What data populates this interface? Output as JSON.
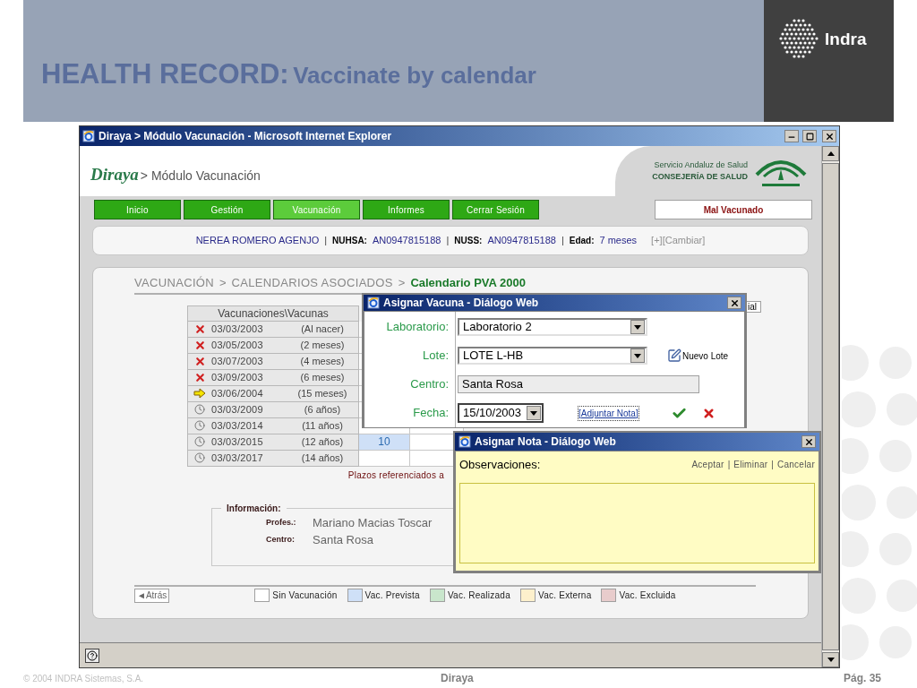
{
  "slide": {
    "title_bold": "HEALTH RECORD:",
    "title_rest": "Vaccinate by calendar",
    "logo_text": "Indra",
    "footer_left": "© 2004 INDRA Sistemas, S.A.",
    "footer_center": "Diraya",
    "footer_right": "Pág. 35"
  },
  "window": {
    "title": "Diraya > Módulo Vacunación - Microsoft Internet Explorer"
  },
  "app_header": {
    "brand": "Diraya",
    "module": "> Módulo Vacunación",
    "org_line1": "Servicio Andaluz de Salud",
    "org_line2": "CONSEJERÍA DE SALUD"
  },
  "nav": [
    {
      "label": "Inicio",
      "selected": false
    },
    {
      "label": "Gestión",
      "selected": false
    },
    {
      "label": "Vacunación",
      "selected": true
    },
    {
      "label": "Informes",
      "selected": false
    },
    {
      "label": "Cerrar Sesión",
      "selected": false
    }
  ],
  "status_badge": "Mal Vacunado",
  "patient": {
    "name": "NEREA ROMERO AGENJO",
    "separator": "|",
    "fields": [
      {
        "label": "NUHSA:",
        "value": "AN0947815188"
      },
      {
        "label": "NUSS:",
        "value": "AN0947815188"
      },
      {
        "label": "Edad:",
        "value": "7 meses"
      }
    ],
    "action": "[+][Cambiar]"
  },
  "breadcrumb": {
    "separator": ">",
    "items": [
      {
        "label": "VACUNACIÓN",
        "current": false
      },
      {
        "label": "CALENDARIOS ASOCIADOS",
        "current": false
      },
      {
        "label": "Calendario PVA 2000",
        "current": true
      }
    ]
  },
  "table": {
    "header": "Vacunaciones\\Vacunas",
    "rows": [
      {
        "kind": "missed",
        "date": "03/03/2003",
        "age": "(Al nacer)"
      },
      {
        "kind": "missed",
        "date": "03/05/2003",
        "age": "(2 meses)"
      },
      {
        "kind": "missed",
        "date": "03/07/2003",
        "age": "(4 meses)"
      },
      {
        "kind": "missed",
        "date": "03/09/2003",
        "age": "(6 meses)"
      },
      {
        "kind": "next",
        "date": "03/06/2004",
        "age": "(15 meses)"
      },
      {
        "kind": "pending",
        "date": "03/03/2009",
        "age": "(6 años)"
      },
      {
        "kind": "pending",
        "date": "03/03/2014",
        "age": "(11 años)"
      },
      {
        "kind": "pending",
        "date": "03/03/2015",
        "age": "(12 años)",
        "entry": "10"
      },
      {
        "kind": "pending",
        "date": "03/03/2017",
        "age": "(14 años)"
      }
    ]
  },
  "note": "Plazos referenciados a",
  "partial_label": "ial",
  "info": {
    "legend": "Información:",
    "rows": [
      {
        "label": "Profes.:",
        "value": "Mariano Macias Toscar"
      },
      {
        "label": "Centro:",
        "value": "Santa Rosa"
      }
    ]
  },
  "back": "◄Atrás",
  "legend": [
    {
      "label": "Sin Vacunación",
      "color": "#ffffff"
    },
    {
      "label": "Vac. Prevista",
      "color": "#cfe0f7"
    },
    {
      "label": "Vac. Realizada",
      "color": "#c9e6cc"
    },
    {
      "label": "Vac. Externa",
      "color": "#fdf0cc"
    },
    {
      "label": "Vac. Excluida",
      "color": "#e8cccc"
    }
  ],
  "dialog_vacuna": {
    "title": "Asignar Vacuna - Diálogo Web",
    "fields": [
      {
        "kind": "select",
        "label": "Laboratorio:",
        "value": "Laboratorio 2"
      },
      {
        "kind": "select",
        "label": "Lote:",
        "value": "LOTE L-HB",
        "action": "Nuevo Lote"
      },
      {
        "kind": "readonly",
        "label": "Centro:",
        "value": "Santa Rosa"
      },
      {
        "kind": "date",
        "label": "Fecha:",
        "value": "15/10/2003",
        "action": "[Adjuntar Nota]"
      }
    ]
  },
  "dialog_nota": {
    "title": "Asignar Nota - Diálogo Web",
    "label": "Observaciones:",
    "separator": "|",
    "actions": [
      "Aceptar",
      "Eliminar",
      "Cancelar"
    ]
  }
}
